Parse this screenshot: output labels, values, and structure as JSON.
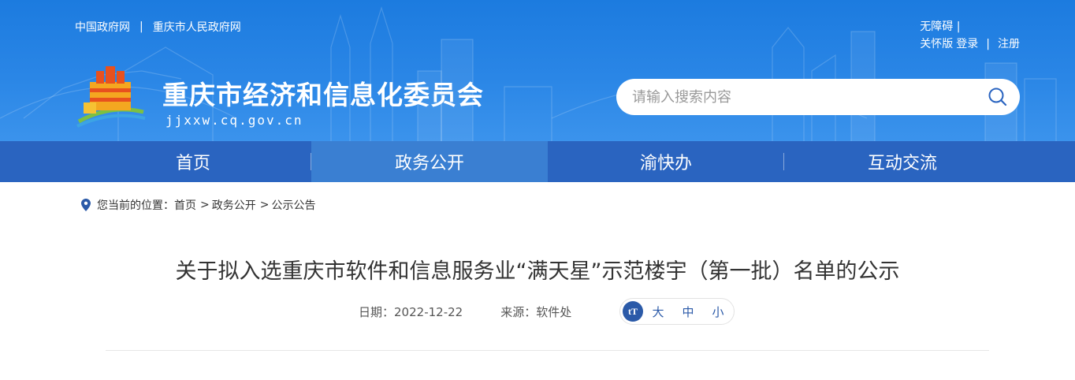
{
  "header": {
    "top_links": [
      "中国政府网",
      "重庆市人民政府网"
    ],
    "separator": "|",
    "accessibility": "无障碍",
    "care_mode": "关怀版",
    "login": "登录",
    "register": "注册",
    "site_title": "重庆市经济和信息化委员会",
    "site_domain": "jjxxw.cq.gov.cn",
    "search": {
      "placeholder": "请输入搜索内容",
      "value": ""
    }
  },
  "nav": {
    "items": [
      "首页",
      "政务公开",
      "渝快办",
      "互动交流"
    ],
    "active_index": 1
  },
  "breadcrumb": {
    "prefix": "您当前的位置：",
    "items": [
      "首页",
      "政务公开",
      "公示公告"
    ],
    "arrow": ">"
  },
  "article": {
    "title": "关于拟入选重庆市软件和信息服务业“满天星”示范楼宇（第一批）名单的公示",
    "date_label": "日期：",
    "date": "2022-12-22",
    "source_label": "来源：",
    "source": "软件处",
    "font_size_icon": "tT",
    "font_sizes": [
      "大",
      "中",
      "小"
    ]
  },
  "colors": {
    "banner": "#2a86e6",
    "nav": "#2a64c0",
    "nav_active": "#3a7fd2",
    "accent": "#2b5aa8"
  },
  "icons": [
    "search-icon",
    "location-pin-icon",
    "logo-emblem",
    "font-size-icon"
  ]
}
